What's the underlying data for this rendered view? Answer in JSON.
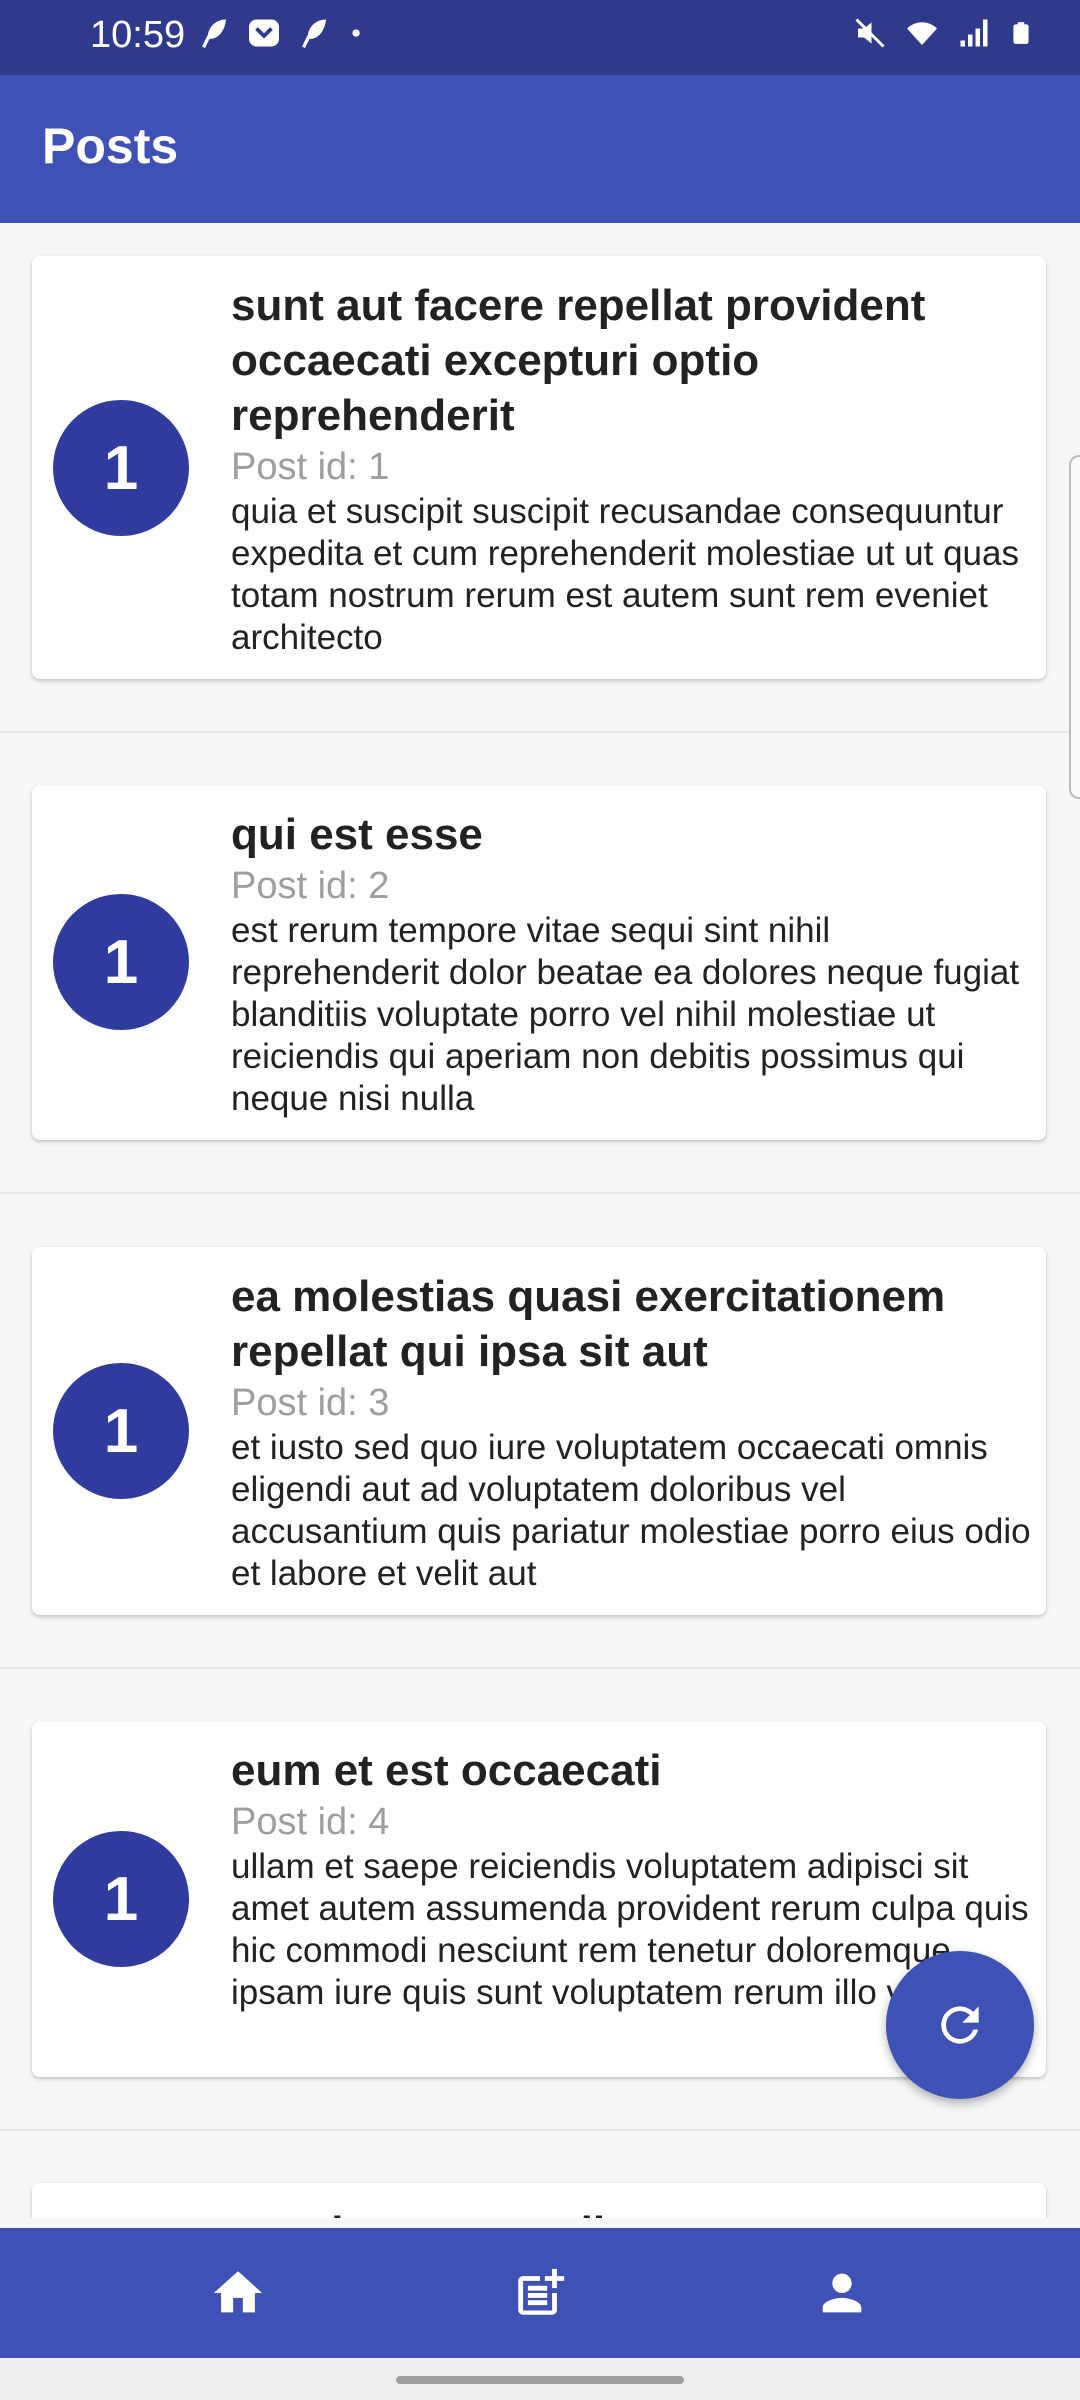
{
  "status_bar": {
    "time": "10:59",
    "left_icons": [
      "feather-icon",
      "pocket-icon",
      "feather-icon",
      "dot-icon"
    ],
    "right_icons": [
      "mute-icon",
      "wifi-icon",
      "signal-icon",
      "battery-icon"
    ]
  },
  "app_bar": {
    "title": "Posts"
  },
  "posts": [
    {
      "avatar": "1",
      "title": "sunt aut facere repellat provident occaecati excepturi optio reprehenderit",
      "post_id": "Post id: 1",
      "body": "quia et suscipit suscipit recusandae consequuntur expedita et cum reprehenderit molestiae ut ut quas totam nostrum rerum est autem sunt rem eveniet architecto"
    },
    {
      "avatar": "1",
      "title": "qui est esse",
      "post_id": "Post id: 2",
      "body": "est rerum tempore vitae sequi sint nihil reprehenderit dolor beatae ea dolores neque fugiat blanditiis voluptate porro vel nihil molestiae ut reiciendis qui aperiam non debitis possimus qui neque nisi nulla"
    },
    {
      "avatar": "1",
      "title": "ea molestias quasi exercitationem repellat qui ipsa sit aut",
      "post_id": "Post id: 3",
      "body": "et iusto sed quo iure voluptatem occaecati omnis eligendi aut ad voluptatem doloribus vel accusantium quis pariatur molestiae porro eius odio et labore et velit aut"
    },
    {
      "avatar": "1",
      "title": "eum et est occaecati",
      "post_id": "Post id: 4",
      "body": "ullam et saepe reiciendis voluptatem adipisci sit amet autem assumenda provident rerum culpa quis hic commodi nesciunt rem tenetur doloremque ipsam iure quis sunt voluptatem rerum illo velit"
    },
    {
      "title": "nesciunt quas odio"
    }
  ],
  "fab": {
    "icon": "refresh-icon"
  },
  "bottom_nav": {
    "items": [
      {
        "icon": "home-icon"
      },
      {
        "icon": "post-add-icon"
      },
      {
        "icon": "person-icon"
      }
    ]
  },
  "colors": {
    "status_bar": "#2f3a8c",
    "primary": "#3f51b5",
    "avatar": "#2f3c9e",
    "background": "#f7f7f7"
  }
}
